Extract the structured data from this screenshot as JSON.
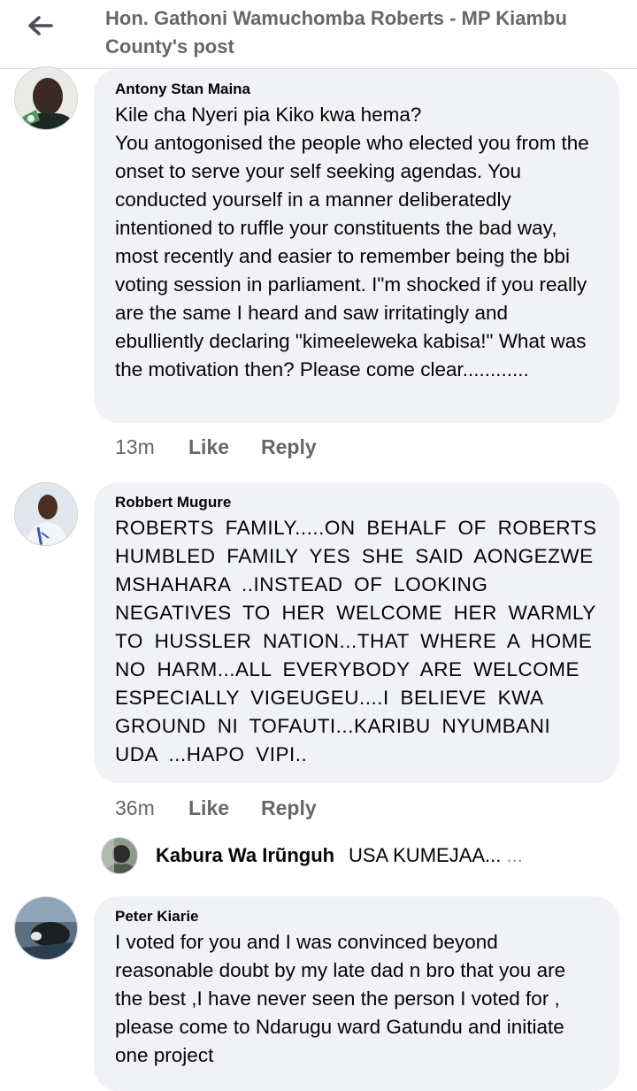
{
  "header": {
    "title": "Hon. Gathoni Wamuchomba Roberts - MP Kiambu County's post"
  },
  "comments": [
    {
      "author": "Antony Stan Maina",
      "text": "Kile cha Nyeri pia Kiko kwa hema?\nYou antogonised the people who elected you from the onset to serve your self seeking agendas. You conducted  yourself in a manner deliberatedly intentioned to ruffle your constituents the bad way, most recently and easier to remember being  the bbi voting session in parliament. I\"m shocked if you really are the same I  heard and saw irritatingly and ebulliently declaring \"kimeeleweka kabisa!\" What was the motivation then? Please come clear............",
      "time": "13m",
      "like": "Like",
      "reply": "Reply"
    },
    {
      "author": "Robbert Mugure",
      "text": "ROBERTS  FAMILY.....ON  BEHALF  OF  ROBERTS HUMBLED  FAMILY  YES  SHE  SAID  AONGEZWE MSHAHARA   ..INSTEAD  OF LOOKING NEGATIVES  TO  HER  WELCOME   HER  WARMLY TO  HUSSLER   NATION...THAT  WHERE  A  HOME NO  HARM...ALL   EVERYBODY  ARE  WELCOME ESPECIALLY   VIGEUGEU....I  BELIEVE  KWA GROUND  NI  TOFAUTI...KARIBU   NYUMBANI UDA   ...HAPO  VIPI..",
      "time": "36m",
      "like": "Like",
      "reply": "Reply"
    },
    {
      "author": "Peter Kiarie",
      "text": "I voted for you and I was convinced beyond reasonable doubt by my late dad n bro that you are the best ,I have never seen the person I voted for , please come to Ndarugu ward Gatundu and initiate one project"
    }
  ],
  "reply_preview": {
    "author": "Kabura Wa Irũnguh",
    "text": "USA KUMEJAA...",
    "more": "..."
  },
  "colors": {
    "bubble": "#f0f2f5",
    "secondary_text": "#65676b",
    "primary_text": "#050505"
  }
}
